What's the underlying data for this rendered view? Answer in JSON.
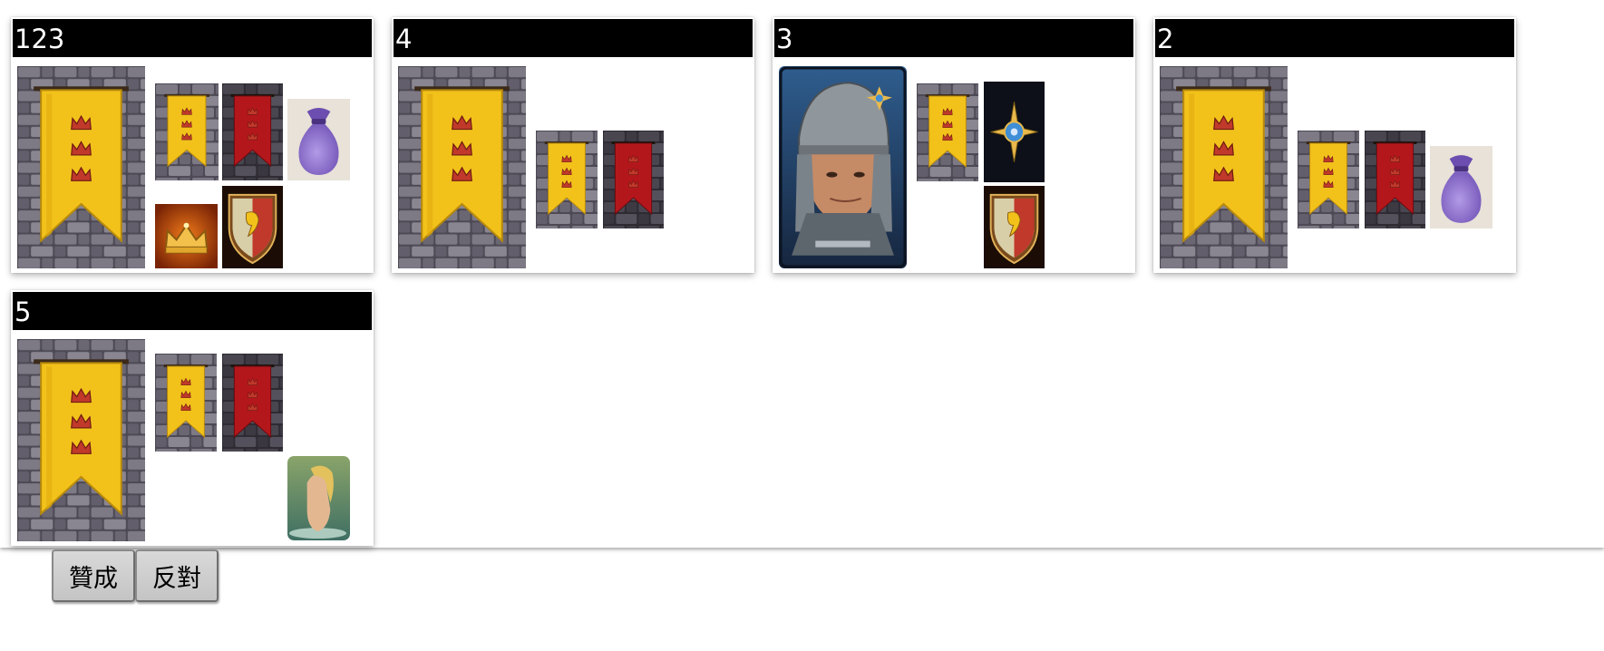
{
  "players": [
    {
      "name": "123"
    },
    {
      "name": "4"
    },
    {
      "name": "3"
    },
    {
      "name": "2"
    },
    {
      "name": "5"
    }
  ],
  "buttons": {
    "approve": "贊成",
    "reject": "反對"
  },
  "colors": {
    "header_bg": "#000000",
    "header_text": "#ffffff",
    "banner_yellow": "#f2c21b",
    "banner_red": "#b3171c",
    "stone_wall": "#5a5560",
    "bag_purple": "#9c7fd6"
  }
}
